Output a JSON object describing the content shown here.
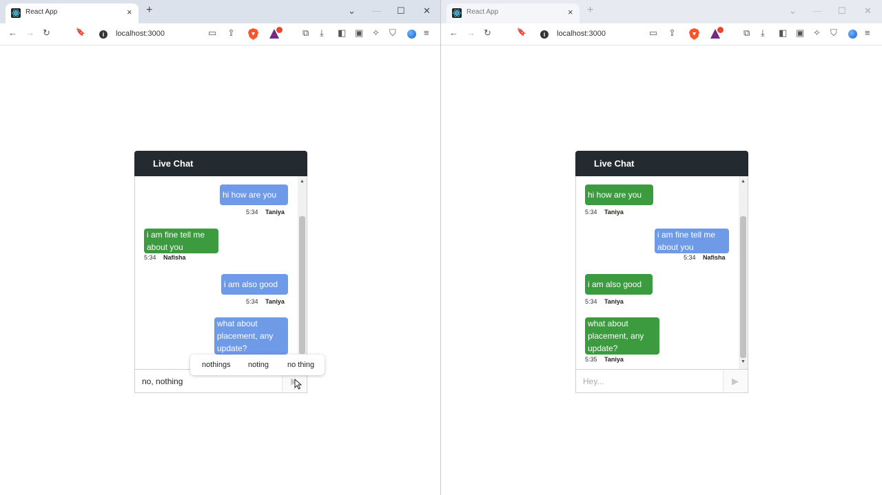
{
  "browser_left": {
    "tab_title": "React App",
    "url": "localhost:3000"
  },
  "browser_right": {
    "tab_title": "React App",
    "url": "localhost:3000"
  },
  "chat_left": {
    "header_title": "Live Chat",
    "input_value": "no, nothing",
    "messages": [
      {
        "text": "hi how are you",
        "time": "5:34",
        "sender": "Taniya"
      },
      {
        "text": "i am fine tell me about you",
        "time": "5:34",
        "sender": "Nafisha"
      },
      {
        "text": "i am also good",
        "time": "5:34",
        "sender": "Taniya"
      },
      {
        "text": "what about placement, any update?"
      }
    ],
    "suggestions": [
      "nothings",
      "noting",
      "no thing"
    ]
  },
  "chat_right": {
    "header_title": "Live Chat",
    "input_placeholder": "Hey...",
    "messages": [
      {
        "text": "hi how are you",
        "time": "5:34",
        "sender": "Taniya"
      },
      {
        "text": "i am fine tell me about you",
        "time": "5:34",
        "sender": "Nafisha"
      },
      {
        "text": "i am also good",
        "time": "5:34",
        "sender": "Taniya"
      },
      {
        "text": "what about placement, any update?",
        "time": "5:35",
        "sender": "Taniya"
      }
    ]
  },
  "icons": {
    "close": "×",
    "new_tab": "+",
    "tab_list": "⌄",
    "minimize": "—",
    "maximize": "☐",
    "window_close": "✕",
    "back": "←",
    "forward": "→",
    "reload": "↻",
    "bookmark": "🔖",
    "site_info": "i",
    "cast": "▭",
    "share": "⇪",
    "extensions": "⧉",
    "download": "⤓",
    "sidebar": "◧",
    "wallet": "▣",
    "leo": "✧",
    "vpn": "⛉",
    "menu": "≡",
    "scroll_up": "▲",
    "scroll_down": "▼",
    "send": "▶"
  },
  "colors": {
    "own_bubble": "#6f9ae8",
    "other_bubble": "#3c9a3f",
    "header_bg": "#232a30"
  }
}
